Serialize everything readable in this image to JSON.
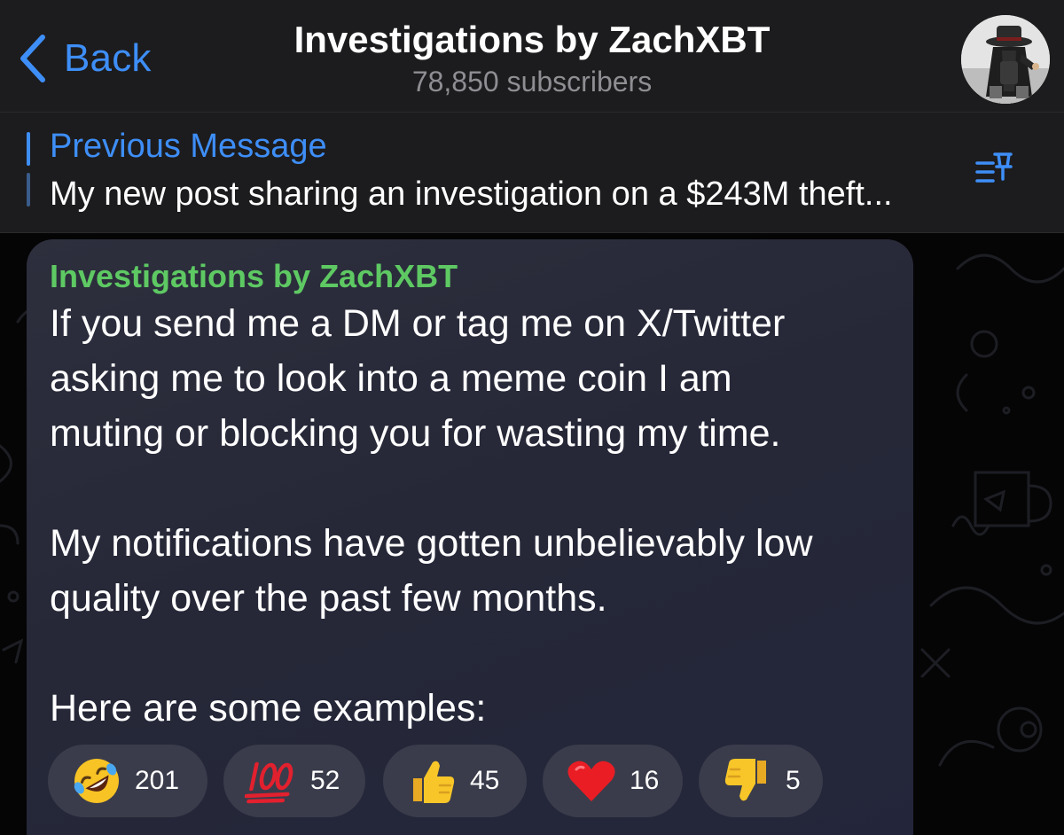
{
  "header": {
    "back_label": "Back",
    "title": "Investigations by ZachXBT",
    "subtitle": "78,850 subscribers"
  },
  "pinned": {
    "label": "Previous Message",
    "text": "My new post sharing an investigation on a $243M theft..."
  },
  "message": {
    "sender": "Investigations by ZachXBT",
    "lines": [
      "If you send me a DM or tag me on X/Twitter",
      "asking me to look into a meme coin I am",
      "muting or blocking you for wasting my time.",
      "My notifications have gotten unbelievably low",
      "quality over the past few months.",
      "Here are some examples:"
    ]
  },
  "reactions": [
    {
      "icon": "rofl-emoji-icon",
      "count": "201"
    },
    {
      "icon": "hundred-points-emoji-icon",
      "count": "52"
    },
    {
      "icon": "thumbs-up-emoji-icon",
      "count": "45"
    },
    {
      "icon": "red-heart-emoji-icon",
      "count": "16"
    },
    {
      "icon": "thumbs-down-emoji-icon",
      "count": "5"
    }
  ],
  "colors": {
    "accent": "#3e8ef7",
    "sender_name": "#5ec963",
    "header_bg": "#1c1c1e",
    "bubble_bg": "#2a2c3c",
    "reaction_bg": "#3a3c4b"
  }
}
